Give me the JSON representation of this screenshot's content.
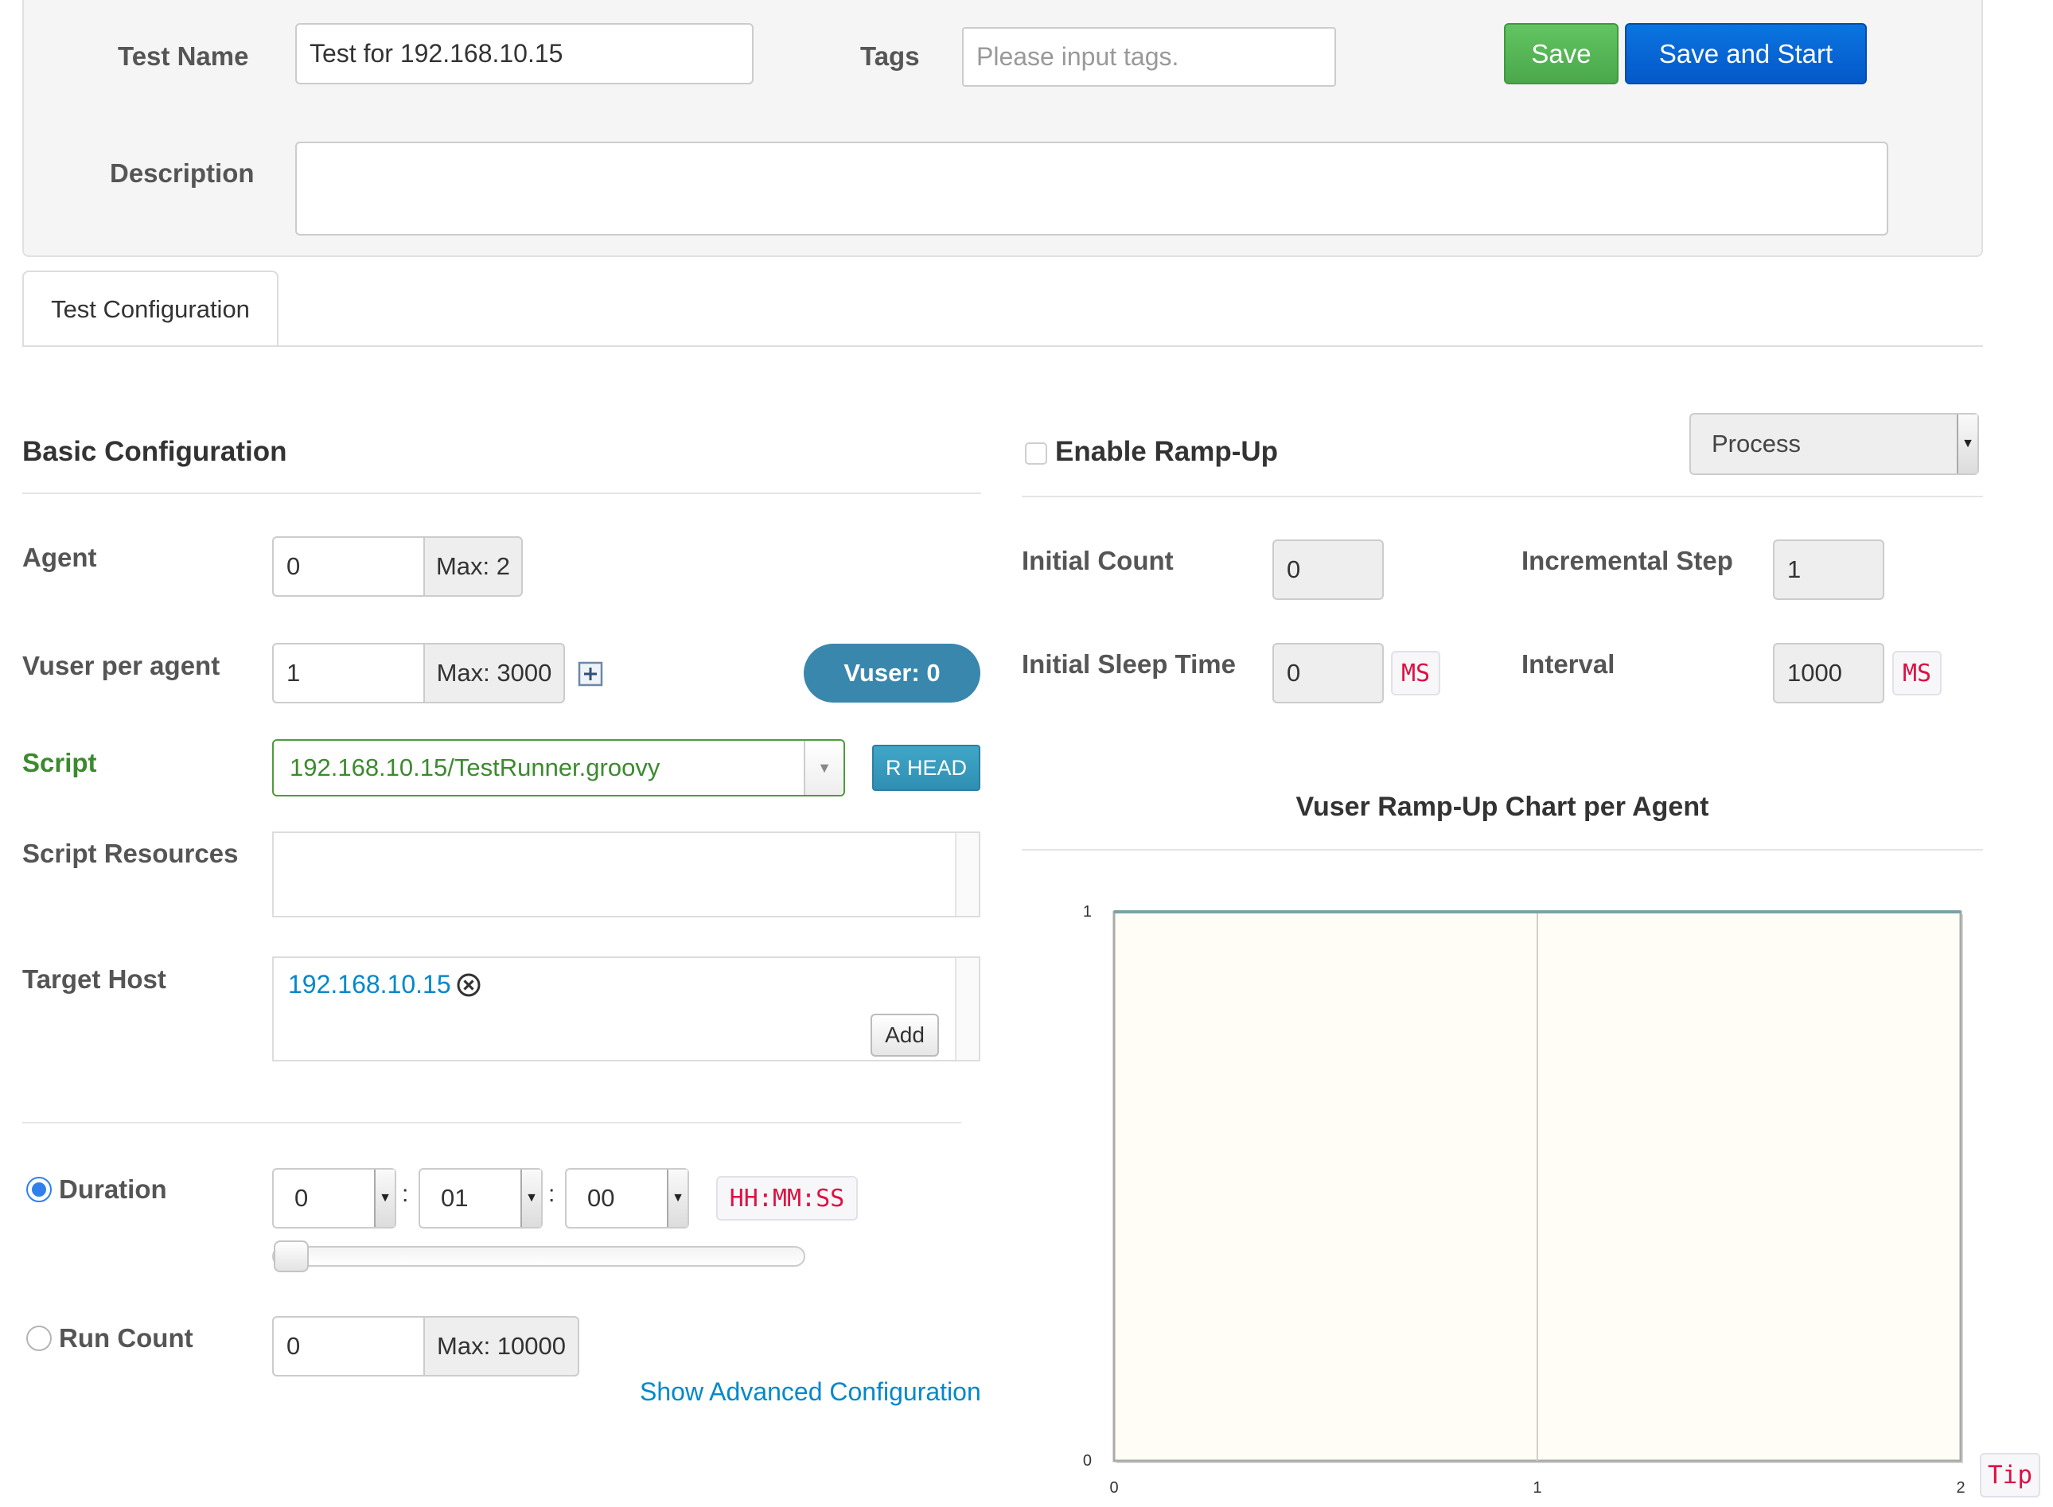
{
  "header": {
    "test_name_label": "Test Name",
    "test_name_value": "Test for 192.168.10.15",
    "tags_label": "Tags",
    "tags_placeholder": "Please input tags.",
    "save_label": "Save",
    "save_start_label": "Save and Start",
    "description_label": "Description",
    "description_value": ""
  },
  "tabs": [
    {
      "label": "Test Configuration",
      "active": true
    }
  ],
  "basic": {
    "title": "Basic Configuration",
    "agent_label": "Agent",
    "agent_value": "0",
    "agent_max": "Max: 2",
    "vuser_label": "Vuser per agent",
    "vuser_value": "1",
    "vuser_max": "Max: 3000",
    "vuser_total": "Vuser: 0",
    "script_label": "Script",
    "script_value": "192.168.10.15/TestRunner.groovy",
    "script_revision": "R HEAD",
    "resources_label": "Script Resources",
    "target_label": "Target Host",
    "target_hosts": [
      "192.168.10.15"
    ],
    "add_label": "Add",
    "duration_label": "Duration",
    "duration_hh": "0",
    "duration_mm": "01",
    "duration_ss": "00",
    "duration_sep": ":",
    "duration_format": "HH:MM:SS",
    "duration_slider_fraction": 0,
    "runcount_label": "Run Count",
    "runcount_value": "0",
    "runcount_max": "Max: 10000",
    "advanced_link": "Show Advanced Configuration"
  },
  "rampup": {
    "enable_label": "Enable Ramp-Up",
    "enabled": false,
    "type_value": "Process",
    "initial_count_label": "Initial Count",
    "initial_count_value": "0",
    "incremental_step_label": "Incremental Step",
    "incremental_step_value": "1",
    "initial_sleep_label": "Initial Sleep Time",
    "initial_sleep_value": "0",
    "interval_label": "Interval",
    "interval_value": "1000",
    "unit_ms": "MS",
    "tip_label": "Tip"
  },
  "chart_data": {
    "type": "line",
    "title": "Vuser Ramp-Up Chart per Agent",
    "xlabel": "",
    "ylabel": "",
    "x_ticks": [
      "0",
      "1",
      "2"
    ],
    "y_ticks": [
      "0",
      "1"
    ],
    "xlim": [
      0,
      2
    ],
    "ylim": [
      0,
      1
    ],
    "series": [
      {
        "x": [
          0,
          2
        ],
        "y": [
          1,
          1
        ]
      }
    ],
    "grid": true
  },
  "colors": {
    "accent_blue": "#0559c9",
    "save_green": "#4aa84a",
    "script_green": "#3c8a2e",
    "vuser_badge": "#3a87ad",
    "link": "#0088cc",
    "code_red": "#dd1144",
    "chart_bg": "#fffdf6"
  },
  "icons": {
    "expand": "plus-square-icon",
    "remove_host": "circle-x-icon",
    "dropdown": "caret-down-icon"
  }
}
